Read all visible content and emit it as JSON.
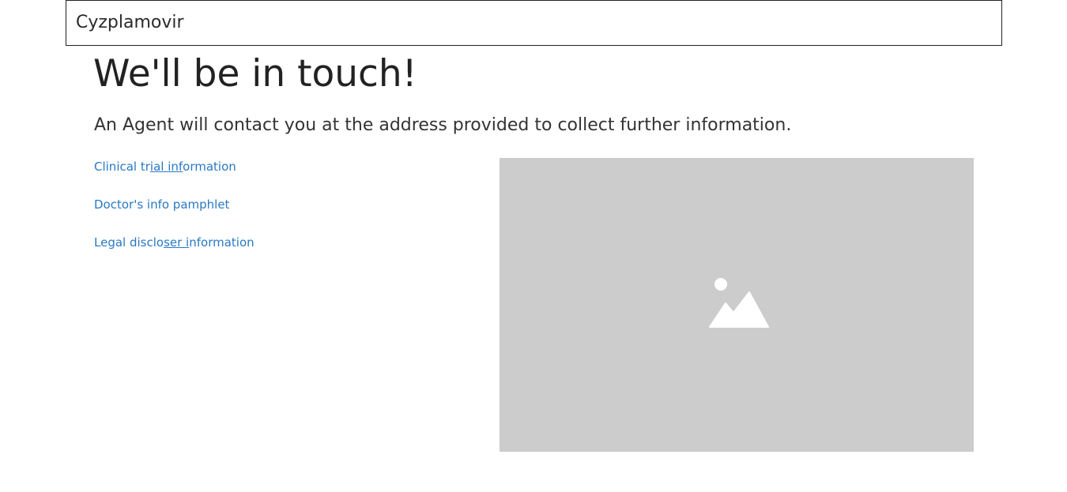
{
  "header": {
    "brand": "Cyzplamovir"
  },
  "main": {
    "title": "We'll be in touch!",
    "subtitle": "An Agent will contact you at the address provided to collect further information.",
    "links": [
      {
        "pre": "Clinical tr",
        "underlined": "ial inf",
        "post": "ormation"
      },
      {
        "pre": "Doctor's info pamphlet",
        "underlined": "",
        "post": ""
      },
      {
        "pre": "Legal disclo",
        "underlined": "ser i",
        "post": "nformation"
      }
    ],
    "image": {
      "icon": "image-placeholder-icon",
      "background": "#cccccc"
    }
  },
  "colors": {
    "link": "#2a78c4",
    "text": "#222222"
  }
}
